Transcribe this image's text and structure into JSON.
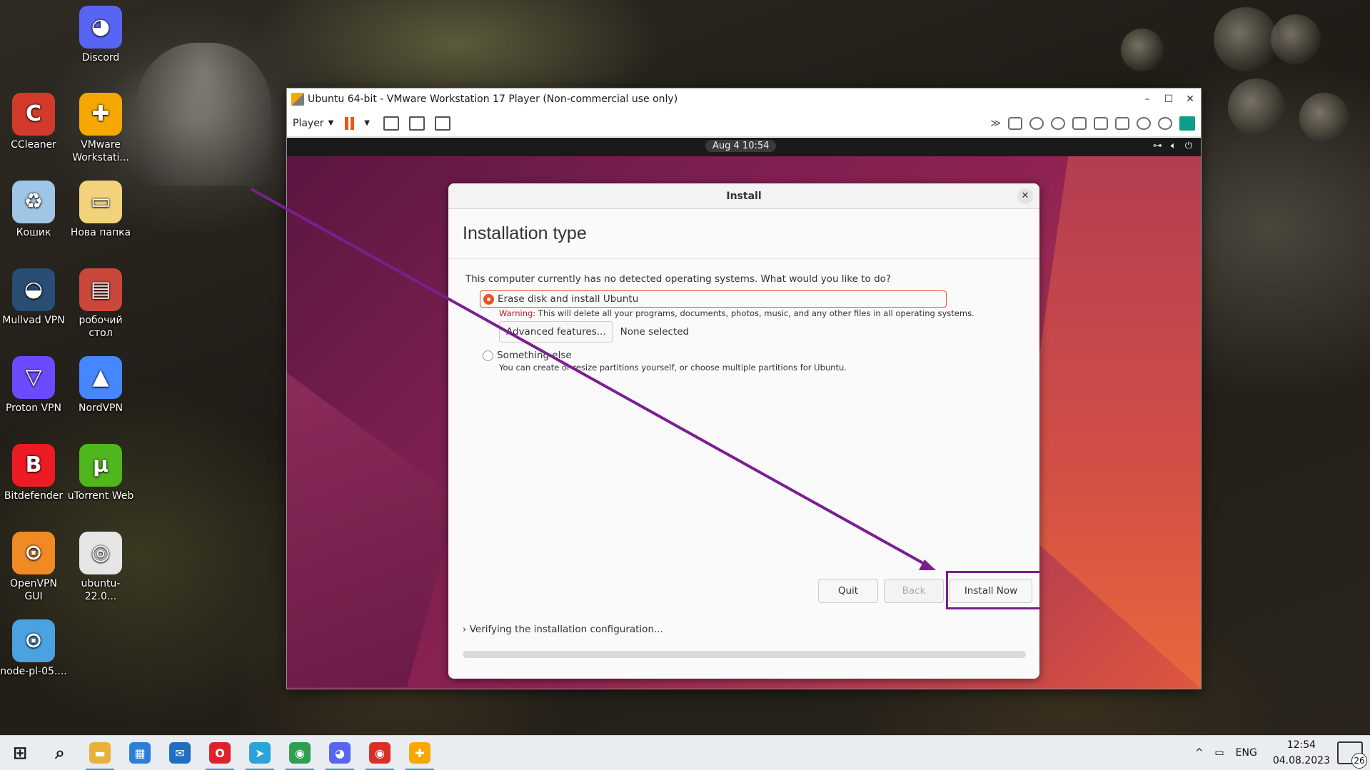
{
  "desktop": {
    "icons": [
      {
        "label": "Discord",
        "color": "#5865f2",
        "glyph": "◕"
      },
      {
        "label": "CCleaner",
        "color": "#d23b2c",
        "glyph": "C"
      },
      {
        "label": "VMware Workstati...",
        "color": "#f6a800",
        "glyph": "✚"
      },
      {
        "label": "Кошик",
        "color": "#9fc6e6",
        "glyph": "♻"
      },
      {
        "label": "Нова папка",
        "color": "#f2d27a",
        "glyph": "▭"
      },
      {
        "label": "Mullvad VPN",
        "color": "#294d73",
        "glyph": "◒"
      },
      {
        "label": "робочий стол",
        "color": "#c9483a",
        "glyph": "▤"
      },
      {
        "label": "Proton VPN",
        "color": "#6d4aff",
        "glyph": "▽"
      },
      {
        "label": "NordVPN",
        "color": "#4687ff",
        "glyph": "▲"
      },
      {
        "label": "Bitdefender",
        "color": "#ed1c24",
        "glyph": "B"
      },
      {
        "label": "uTorrent Web",
        "color": "#4fb61d",
        "glyph": "μ"
      },
      {
        "label": "OpenVPN GUI",
        "color": "#f08a24",
        "glyph": "⊙"
      },
      {
        "label": "ubuntu-22.0...",
        "color": "#e6e6e6",
        "glyph": "◎"
      },
      {
        "label": "node-pl-05....",
        "color": "#4aa3e0",
        "glyph": "⊙"
      }
    ]
  },
  "vmware": {
    "title": "Ubuntu 64-bit - VMware Workstation 17 Player (Non-commercial use only)",
    "player_menu": "Player",
    "controls": {
      "minimize": "–",
      "maximize": "☐",
      "close": "✕"
    }
  },
  "gnome": {
    "clock": "Aug 4  10:54",
    "status_icons": [
      "network-icon",
      "volume-icon",
      "power-icon"
    ]
  },
  "installer": {
    "header": "Install",
    "close": "✕",
    "title": "Installation type",
    "question": "This computer currently has no detected operating systems. What would you like to do?",
    "option1": {
      "label": "Erase disk and install Ubuntu",
      "warning_prefix": "Warning:",
      "warning_text": " This will delete all your programs, documents, photos, music, and any other files in all operating systems.",
      "advanced_button": "Advanced features...",
      "advanced_value": "None selected",
      "selected": true
    },
    "option2": {
      "label": "Something else",
      "description": "You can create or resize partitions yourself, or choose multiple partitions for Ubuntu.",
      "selected": false
    },
    "buttons": {
      "quit": "Quit",
      "back": "Back",
      "install": "Install Now"
    },
    "progress_label": "Verifying the installation configuration...",
    "progress_chevron": "›"
  },
  "annotation": {
    "color": "#7a1f8f"
  },
  "taskbar": {
    "apps": [
      {
        "name": "start",
        "glyph": "⊞",
        "color": "#1a1a1a"
      },
      {
        "name": "search",
        "glyph": "⌕",
        "color": "#1a1a1a"
      },
      {
        "name": "explorer",
        "glyph": "▬",
        "color": "#e8b23a"
      },
      {
        "name": "store",
        "glyph": "▦",
        "color": "#2b7fd8"
      },
      {
        "name": "mail",
        "glyph": "✉",
        "color": "#1e6fc2"
      },
      {
        "name": "opera",
        "glyph": "O",
        "color": "#e0202a"
      },
      {
        "name": "telegram",
        "glyph": "➤",
        "color": "#2aa3db"
      },
      {
        "name": "chrome",
        "glyph": "◉",
        "color": "#2e9e4f"
      },
      {
        "name": "discord",
        "glyph": "◕",
        "color": "#5865f2"
      },
      {
        "name": "chrome-2",
        "glyph": "◉",
        "color": "#d93025"
      },
      {
        "name": "vmware",
        "glyph": "✚",
        "color": "#f6a800"
      }
    ],
    "tray": {
      "chevron": "^",
      "lang": "ENG",
      "time": "12:54",
      "date": "04.08.2023",
      "notifications": "26"
    }
  }
}
